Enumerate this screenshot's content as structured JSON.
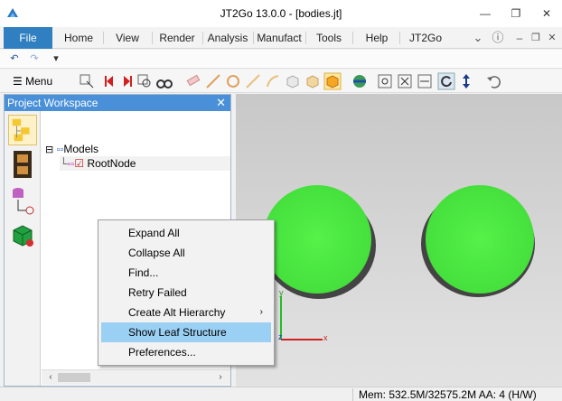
{
  "window": {
    "title": "JT2Go 13.0.0 - [bodies.jt]",
    "controls": [
      "minimize-icon",
      "restore-icon",
      "close-icon"
    ]
  },
  "ribbon": {
    "tabs": [
      {
        "label": "File",
        "active": true
      },
      {
        "label": "Home"
      },
      {
        "label": "View"
      },
      {
        "label": "Render"
      },
      {
        "label": "Analysis"
      },
      {
        "label": "Manufact"
      },
      {
        "label": "Tools"
      },
      {
        "label": "Help"
      },
      {
        "label": "JT2Go"
      }
    ],
    "right_icons": [
      "chevron-down-icon",
      "help-icon",
      "minimize-icon",
      "restore-icon",
      "close-icon"
    ]
  },
  "quick_access": {
    "icons": [
      "undo-icon",
      "redo-icon",
      "customize-icon"
    ]
  },
  "toolbar": {
    "menu_label": "Menu",
    "icons": [
      "select-icon",
      "previous-step-icon",
      "next-step-icon",
      "zoom-box-icon",
      "binoculars-icon",
      "measure-icon",
      "line-icon",
      "circle-icon",
      "slope-icon",
      "arc-icon",
      "box-icon",
      "solid-box-icon",
      "highlight-box-icon",
      "globe-render-icon",
      "fit-view-icon",
      "fit-all-icon",
      "fit-width-icon",
      "rotate-icon",
      "vertical-pan-icon",
      "undo-view-icon"
    ]
  },
  "workspace": {
    "title": "Project Workspace",
    "close_glyph": "✕",
    "side_icons": [
      "project-tree-icon",
      "film-strip-icon",
      "database-icon",
      "model-views-icon"
    ],
    "tree": [
      {
        "label": "Models",
        "expander": "⊟"
      },
      {
        "label": "RootNode",
        "checked": true
      }
    ]
  },
  "context_menu": {
    "items": [
      {
        "label": "Expand All"
      },
      {
        "label": "Collapse All"
      },
      {
        "label": "Find..."
      },
      {
        "label": "Retry Failed"
      },
      {
        "label": "Create Alt Hierarchy",
        "submenu": true
      },
      {
        "label": "Show Leaf Structure",
        "highlighted": true
      },
      {
        "label": "Preferences..."
      }
    ]
  },
  "viewport": {
    "axes": {
      "y": "y",
      "z": "z",
      "x": "x"
    },
    "sphere_color": "#4ff045",
    "background": "#d4d4d4"
  },
  "status": {
    "text": "Mem: 532.5M/32575.2M  AA: 4 (H/W)"
  },
  "colors": {
    "accent": "#2f7fc1",
    "panel_header": "#4a90d8",
    "menu_highlight": "#9bd0f5"
  }
}
